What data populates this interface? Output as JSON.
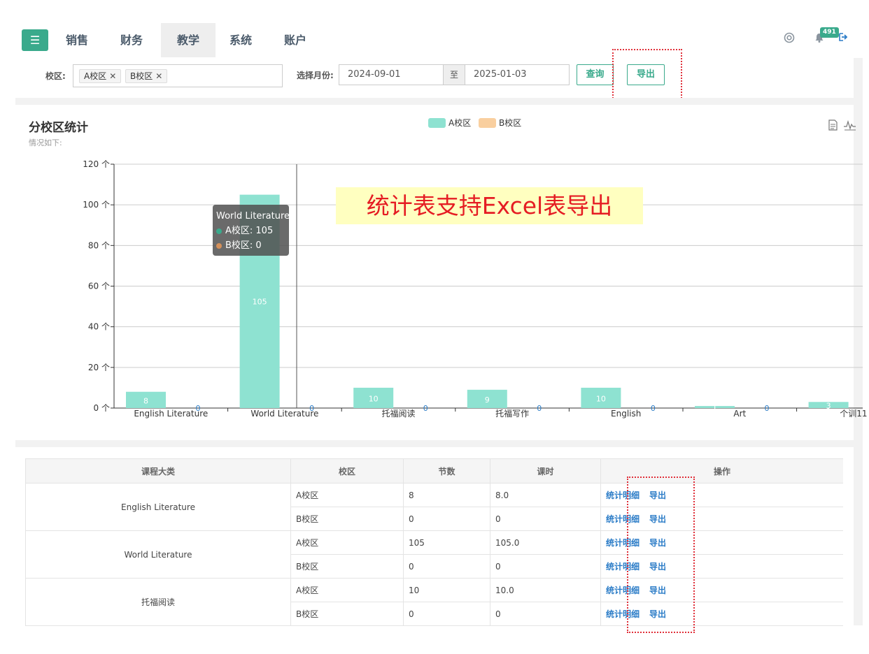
{
  "nav": {
    "tabs": [
      {
        "label": "销售"
      },
      {
        "label": "财务"
      },
      {
        "label": "教学",
        "active": true
      },
      {
        "label": "系统"
      },
      {
        "label": "账户"
      }
    ],
    "notification_count": "491",
    "icons": [
      "menu-icon",
      "help-icon",
      "bell-icon",
      "logout-icon"
    ]
  },
  "filters": {
    "campus_label": "校区:",
    "campus_tags": [
      "A校区",
      "B校区"
    ],
    "month_label": "选择月份:",
    "date_from": "2024-09-01",
    "date_sep": "至",
    "date_to": "2025-01-03",
    "query_button": "查询",
    "export_button": "导出"
  },
  "chart_panel": {
    "title": "分校区统计",
    "subtitle": "情况如下:",
    "annotation": "统计表支持Excel表导出",
    "tooltip": {
      "title": "World Literature",
      "line1": "A校区: 105",
      "line2": "B校区: 0"
    }
  },
  "colors": {
    "accent": "#3aaa8c",
    "series_a": "#8ee2d1",
    "series_b": "#f9cf9f",
    "link": "#2b7cc7"
  },
  "chart_data": {
    "type": "bar",
    "categories": [
      "English Literature",
      "World Literature",
      "托福阅读",
      "托福写作",
      "English",
      "Art",
      "个训11"
    ],
    "series": [
      {
        "name": "A校区",
        "values": [
          8,
          105,
          10,
          9,
          10,
          1,
          3
        ]
      },
      {
        "name": "B校区",
        "values": [
          0,
          0,
          0,
          0,
          0,
          0,
          0
        ]
      }
    ],
    "ylim": [
      0,
      120
    ],
    "yticks": [
      0,
      20,
      40,
      60,
      80,
      100,
      120
    ],
    "ytick_suffix": " 个",
    "legend": "top-center",
    "grid": true
  },
  "table": {
    "headers": [
      "课程大类",
      "校区",
      "节数",
      "课时",
      "操作"
    ],
    "groups": [
      {
        "category": "English Literature",
        "rows": [
          {
            "campus": "A校区",
            "sessions": "8",
            "hours": "8.0"
          },
          {
            "campus": "B校区",
            "sessions": "0",
            "hours": "0"
          }
        ]
      },
      {
        "category": "World Literature",
        "rows": [
          {
            "campus": "A校区",
            "sessions": "105",
            "hours": "105.0"
          },
          {
            "campus": "B校区",
            "sessions": "0",
            "hours": "0"
          }
        ]
      },
      {
        "category": "托福阅读",
        "rows": [
          {
            "campus": "A校区",
            "sessions": "10",
            "hours": "10.0"
          },
          {
            "campus": "B校区",
            "sessions": "0",
            "hours": "0"
          }
        ]
      }
    ],
    "action_detail": "统计明细",
    "action_export": "导出"
  }
}
